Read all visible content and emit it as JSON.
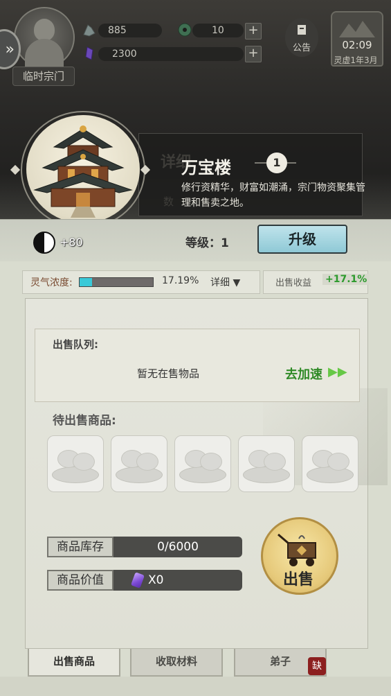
{
  "hud": {
    "sect_name": "临时宗门",
    "stone_value": "885",
    "jade_value": "10",
    "gem_value": "2300",
    "plus_label": "+",
    "notice_label": "公告",
    "time": "02:09",
    "date": "灵虚1年3月"
  },
  "building": {
    "ghost_tab": "详细",
    "ghost_sub": "数",
    "name": "万宝楼",
    "level_badge": "1",
    "description": "修行资精华，财富如潮涌，宗门物资聚集管理和售卖之地。"
  },
  "strip": {
    "yinyang_value": "+80",
    "level_label": "等级：1",
    "upgrade_label": "升级"
  },
  "spirit": {
    "label": "灵气浓度:",
    "percent_text": "17.19%",
    "percent_value": 17.19,
    "detail_label": "详细 ▼"
  },
  "income": {
    "label": "出售收益",
    "value": "+17.1%"
  },
  "queue": {
    "title": "出售队列:",
    "empty_text": "暂无在售物品",
    "speedup_label": "去加速",
    "speedup_arrows": "▶▶"
  },
  "pending": {
    "title": "待出售商品:"
  },
  "stock": {
    "label": "商品库存",
    "value": "0/6000"
  },
  "price": {
    "label": "商品价值",
    "value": "X0"
  },
  "sell_button": "出售",
  "tabs": [
    {
      "label": "出售商品"
    },
    {
      "label": "收取材料"
    },
    {
      "label": "弟子"
    }
  ],
  "lack_badge": "缺",
  "colors": {
    "accent_green": "#2f8a26",
    "spirit_fill": "#39c9d8",
    "upgrade_button": "#8fc9d6",
    "sell_button": "#e6c97a",
    "lack_badge": "#8c1f1f"
  }
}
